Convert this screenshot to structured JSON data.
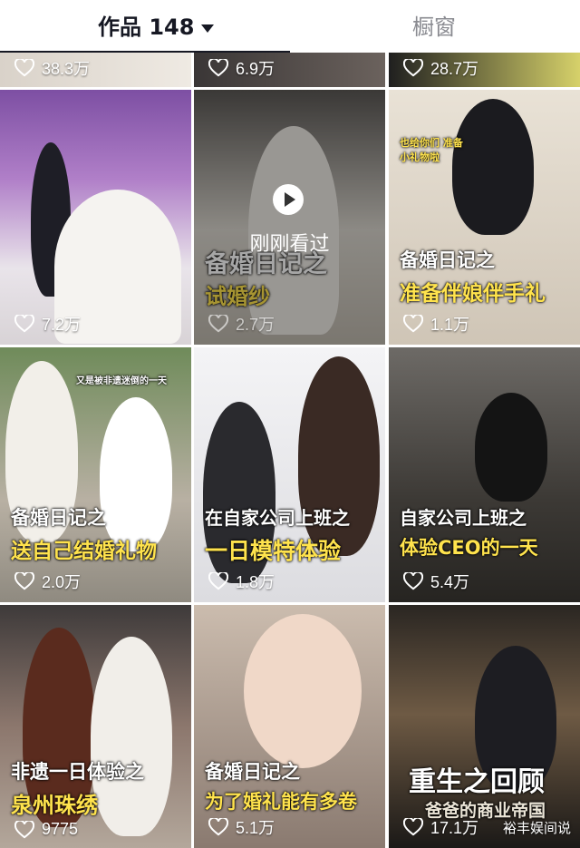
{
  "tabs": {
    "works_label": "作品 148",
    "window_label": "橱窗"
  },
  "top_row": [
    {
      "likes": "38.3万"
    },
    {
      "likes": "6.9万"
    },
    {
      "likes": "28.7万"
    }
  ],
  "tiles": [
    {
      "likes": "7.2万",
      "caption1": "",
      "caption2": ""
    },
    {
      "likes": "2.7万",
      "caption1": "备婚日记之",
      "caption2": "试婚纱",
      "overlay": "刚刚看过"
    },
    {
      "likes": "1.1万",
      "caption1": "备婚日记之",
      "caption2": "准备伴娘伴手礼",
      "sticker": "也给你们 准备小礼物啦"
    },
    {
      "likes": "2.0万",
      "caption1": "备婚日记之",
      "caption2": "送自己结婚礼物",
      "sticker": "又是被非遗迷倒的一天"
    },
    {
      "likes": "1.8万",
      "caption1": "在自家公司上班之",
      "caption2": "一日模特体验"
    },
    {
      "likes": "5.4万",
      "caption1": "自家公司上班之",
      "caption2": "体验CEO的一天"
    },
    {
      "likes": "9775",
      "caption1": "非遗一日体验之",
      "caption2": "泉州珠绣"
    },
    {
      "likes": "5.1万",
      "caption1": "备婚日记之",
      "caption2": "为了婚礼能有多卷"
    },
    {
      "likes": "17.1万",
      "caption1": "重生之回顾",
      "caption2": "爸爸的商业帝国"
    }
  ],
  "watermark": "裕丰娱间说"
}
